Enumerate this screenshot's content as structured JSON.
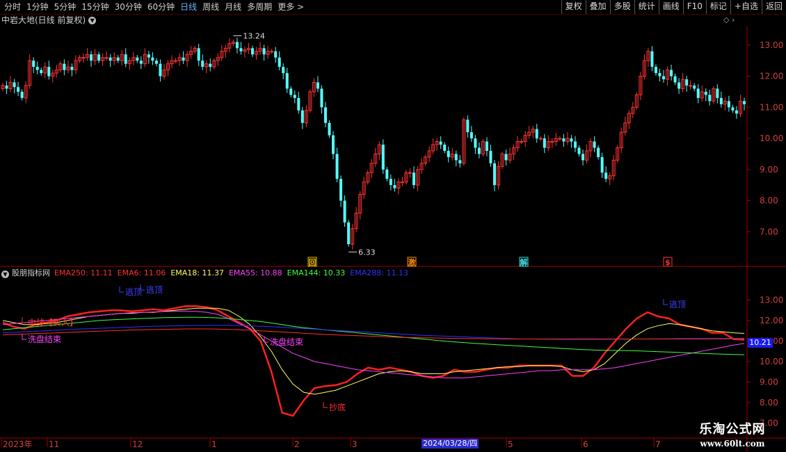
{
  "periods": [
    {
      "label": "分时",
      "active": false
    },
    {
      "label": "1分钟",
      "active": false
    },
    {
      "label": "5分钟",
      "active": false
    },
    {
      "label": "15分钟",
      "active": false
    },
    {
      "label": "30分钟",
      "active": false
    },
    {
      "label": "60分钟",
      "active": false
    },
    {
      "label": "日线",
      "active": true
    },
    {
      "label": "周线",
      "active": false
    },
    {
      "label": "月线",
      "active": false
    },
    {
      "label": "多周期",
      "active": false
    },
    {
      "label": "更多 >",
      "active": false
    }
  ],
  "tools": [
    "复权",
    "叠加",
    "多股",
    "统计",
    "画线",
    "F10",
    "标记",
    "+自选",
    "返回"
  ],
  "stock_title": "中岩大地(日线 前复权)",
  "price_axis": [
    "13.00",
    "12.00",
    "11.00",
    "10.00",
    "9.00",
    "8.00",
    "7.00"
  ],
  "high_label": "13.24",
  "low_label": "6.33",
  "markers": [
    {
      "text": "回",
      "color": "#f0c000"
    },
    {
      "text": "激",
      "color": "#ff8c00"
    },
    {
      "text": "解",
      "color": "#40e0e0"
    },
    {
      "text": "$",
      "color": "#ff3030"
    }
  ],
  "indicator": {
    "name": "股朋指标网",
    "emas": [
      {
        "label": "EMA250: 11.11",
        "color": "#ff3030"
      },
      {
        "label": "EMA6: 11.06",
        "color": "#ff3030"
      },
      {
        "label": "EMA18: 11.37",
        "color": "#ffff60"
      },
      {
        "label": "EMA55: 10.88",
        "color": "#ff40ff"
      },
      {
        "label": "EMA144: 10.33",
        "color": "#40ff40"
      },
      {
        "label": "EMA288: 11.13",
        "color": "#3030ff"
      }
    ],
    "axis": [
      "13.00",
      "12.00",
      "11.00",
      "10.00",
      "9.00",
      "8.00",
      "7.00"
    ],
    "last_value": "10.21",
    "annotations": [
      {
        "text": "中线【买入】",
        "color": "#ff3030"
      },
      {
        "text": "洗盘结束",
        "color": "#ff40ff"
      },
      {
        "text": "逃顶",
        "color": "#4040ff"
      },
      {
        "text": "逃顶",
        "color": "#4040ff"
      },
      {
        "text": "洗盘结束",
        "color": "#ff40ff"
      },
      {
        "text": "抄底",
        "color": "#ff3030"
      },
      {
        "text": "逃顶",
        "color": "#4040ff"
      }
    ]
  },
  "date_axis": [
    "2023年",
    "11",
    "12",
    "1",
    "2",
    "3",
    "5",
    "6",
    "7"
  ],
  "cursor_date": "2024/03/28/四",
  "watermark": {
    "line1": "乐淘公式网",
    "line2": "www.60lt.com"
  },
  "chart_data": [
    {
      "type": "candlestick",
      "title": "中岩大地(日线 前复权)",
      "y_range": [
        6.0,
        13.6
      ],
      "note": "close prices per day (approx.)",
      "close": [
        11.7,
        11.6,
        11.8,
        11.65,
        11.5,
        11.3,
        11.7,
        12.5,
        12.3,
        12.2,
        12.1,
        12.3,
        12.0,
        12.1,
        12.2,
        12.4,
        12.2,
        12.3,
        12.2,
        12.5,
        12.6,
        12.6,
        12.7,
        12.5,
        12.7,
        12.5,
        12.6,
        12.6,
        12.5,
        12.6,
        12.5,
        12.7,
        12.4,
        12.5,
        12.6,
        12.5,
        12.4,
        12.7,
        12.6,
        12.5,
        12.4,
        12.0,
        12.2,
        12.4,
        12.5,
        12.5,
        12.6,
        12.5,
        12.7,
        12.8,
        12.9,
        12.5,
        12.3,
        12.4,
        12.3,
        12.5,
        12.6,
        12.8,
        12.9,
        13.05,
        13.1,
        12.9,
        12.8,
        12.85,
        12.9,
        12.7,
        12.8,
        12.9,
        12.7,
        12.8,
        12.8,
        12.6,
        12.3,
        12.1,
        11.6,
        11.4,
        11.3,
        10.9,
        10.5,
        10.9,
        11.5,
        11.8,
        11.6,
        11.0,
        10.5,
        10.1,
        9.5,
        8.7,
        8.0,
        7.3,
        6.6,
        7.1,
        7.6,
        8.2,
        8.6,
        8.9,
        9.2,
        9.5,
        9.8,
        9.0,
        8.7,
        8.5,
        8.4,
        8.6,
        8.6,
        8.9,
        8.9,
        8.5,
        9.0,
        9.2,
        9.4,
        9.6,
        9.8,
        9.9,
        9.8,
        9.6,
        9.4,
        9.5,
        9.3,
        9.2,
        10.6,
        10.2,
        10.0,
        9.7,
        9.5,
        9.9,
        9.6,
        9.2,
        8.5,
        9.1,
        9.5,
        9.3,
        9.5,
        9.7,
        9.9,
        9.9,
        10.1,
        10.2,
        10.3,
        10.0,
        10.0,
        9.7,
        9.9,
        9.9,
        10.0,
        10.0,
        9.9,
        10.0,
        9.9,
        9.7,
        9.5,
        9.3,
        9.6,
        9.9,
        9.7,
        9.4,
        8.9,
        8.7,
        8.8,
        9.3,
        9.7,
        10.2,
        10.5,
        10.8,
        11.0,
        11.4,
        12.0,
        12.5,
        12.8,
        12.3,
        12.1,
        12.0,
        11.9,
        12.2,
        12.0,
        11.8,
        11.6,
        11.9,
        11.7,
        11.7,
        11.6,
        11.3,
        11.5,
        11.4,
        11.2,
        11.6,
        11.3,
        11.1,
        11.2,
        11.0,
        10.9,
        10.8,
        11.2,
        11.1
      ]
    },
    {
      "type": "line",
      "title": "股朋指标网",
      "y_range": [
        6.5,
        14.0
      ],
      "series": [
        {
          "name": "EMA6",
          "color": "#ff2020",
          "values": [
            11.9,
            11.7,
            11.6,
            11.8,
            11.9,
            12.0,
            12.2,
            12.3,
            12.4,
            12.45,
            12.5,
            12.5,
            12.45,
            12.5,
            12.55,
            12.5,
            12.6,
            12.7,
            12.7,
            12.65,
            12.5,
            12.2,
            11.9,
            11.6,
            11.0,
            9.5,
            7.5,
            7.35,
            8.1,
            8.7,
            8.8,
            8.85,
            9.0,
            9.4,
            9.7,
            9.6,
            9.7,
            9.6,
            9.5,
            9.3,
            9.2,
            9.3,
            9.6,
            9.5,
            9.5,
            9.6,
            9.7,
            9.7,
            9.8,
            9.8,
            9.8,
            9.8,
            9.8,
            9.3,
            9.3,
            9.7,
            10.4,
            11.0,
            11.6,
            12.1,
            12.4,
            12.2,
            12.1,
            11.8,
            11.7,
            11.6,
            11.4,
            11.4,
            11.1,
            11.06
          ]
        },
        {
          "name": "EMA18",
          "color": "#ffff60",
          "values": [
            12.0,
            11.9,
            11.8,
            11.8,
            11.85,
            11.9,
            12.0,
            12.1,
            12.2,
            12.25,
            12.3,
            12.35,
            12.35,
            12.4,
            12.4,
            12.45,
            12.5,
            12.55,
            12.6,
            12.6,
            12.6,
            12.5,
            12.2,
            11.8,
            11.2,
            10.5,
            9.6,
            8.9,
            8.5,
            8.4,
            8.5,
            8.6,
            8.8,
            9.0,
            9.2,
            9.4,
            9.5,
            9.55,
            9.5,
            9.4,
            9.4,
            9.4,
            9.5,
            9.55,
            9.6,
            9.65,
            9.7,
            9.75,
            9.75,
            9.8,
            9.8,
            9.8,
            9.75,
            9.6,
            9.5,
            9.6,
            9.9,
            10.4,
            10.9,
            11.3,
            11.6,
            11.75,
            11.85,
            11.8,
            11.7,
            11.6,
            11.5,
            11.45,
            11.4,
            11.37
          ]
        },
        {
          "name": "EMA55",
          "color": "#ff40ff",
          "values": [
            11.8,
            11.85,
            11.9,
            11.95,
            12.0,
            12.05,
            12.1,
            12.15,
            12.2,
            12.25,
            12.3,
            12.35,
            12.38,
            12.4,
            12.42,
            12.44,
            12.45,
            12.46,
            12.45,
            12.4,
            12.3,
            12.1,
            11.85,
            11.6,
            11.3,
            11.0,
            10.7,
            10.4,
            10.2,
            10.0,
            9.9,
            9.8,
            9.7,
            9.6,
            9.55,
            9.5,
            9.45,
            9.4,
            9.35,
            9.3,
            9.25,
            9.2,
            9.2,
            9.2,
            9.25,
            9.3,
            9.35,
            9.4,
            9.45,
            9.5,
            9.55,
            9.55,
            9.6,
            9.6,
            9.6,
            9.6,
            9.65,
            9.7,
            9.8,
            9.9,
            10.0,
            10.1,
            10.2,
            10.3,
            10.4,
            10.5,
            10.6,
            10.7,
            10.8,
            10.88
          ]
        },
        {
          "name": "EMA144",
          "color": "#40ff40",
          "values": [
            11.55,
            11.6,
            11.65,
            11.7,
            11.75,
            11.8,
            11.85,
            11.9,
            11.95,
            12.0,
            12.03,
            12.06,
            12.08,
            12.1,
            12.12,
            12.14,
            12.15,
            12.16,
            12.16,
            12.15,
            12.13,
            12.1,
            12.05,
            12.0,
            11.95,
            11.88,
            11.8,
            11.72,
            11.65,
            11.6,
            11.55,
            11.5,
            11.45,
            11.4,
            11.35,
            11.3,
            11.25,
            11.2,
            11.15,
            11.1,
            11.05,
            11.0,
            10.96,
            10.92,
            10.88,
            10.85,
            10.82,
            10.79,
            10.76,
            10.73,
            10.7,
            10.67,
            10.64,
            10.61,
            10.58,
            10.56,
            10.55,
            10.54,
            10.53,
            10.52,
            10.5,
            10.48,
            10.46,
            10.44,
            10.42,
            10.4,
            10.38,
            10.36,
            10.34,
            10.33
          ]
        },
        {
          "name": "EMA288",
          "color": "#3030ff",
          "values": [
            11.4,
            11.42,
            11.45,
            11.48,
            11.5,
            11.53,
            11.56,
            11.58,
            11.6,
            11.62,
            11.64,
            11.66,
            11.68,
            11.7,
            11.72,
            11.73,
            11.74,
            11.75,
            11.76,
            11.77,
            11.77,
            11.77,
            11.76,
            11.74,
            11.72,
            11.7,
            11.67,
            11.64,
            11.61,
            11.58,
            11.55,
            11.52,
            11.49,
            11.46,
            11.43,
            11.4,
            11.37,
            11.34,
            11.31,
            11.28,
            11.26,
            11.24,
            11.22,
            11.2,
            11.18,
            11.16,
            11.14,
            11.12,
            11.1,
            11.1,
            11.09,
            11.09,
            11.08,
            11.08,
            11.08,
            11.08,
            11.08,
            11.09,
            11.09,
            11.1,
            11.1,
            11.11,
            11.11,
            11.12,
            11.12,
            11.12,
            11.13,
            11.13,
            11.13,
            11.13
          ]
        },
        {
          "name": "EMA250",
          "color": "#ff3030",
          "values": [
            11.3,
            11.32,
            11.34,
            11.36,
            11.38,
            11.4,
            11.42,
            11.44,
            11.46,
            11.48,
            11.5,
            11.52,
            11.54,
            11.55,
            11.56,
            11.57,
            11.58,
            11.59,
            11.59,
            11.59,
            11.58,
            11.57,
            11.55,
            11.53,
            11.5,
            11.47,
            11.44,
            11.41,
            11.38,
            11.35,
            11.32,
            11.3,
            11.28,
            11.26,
            11.24,
            11.22,
            11.2,
            11.18,
            11.17,
            11.16,
            11.15,
            11.14,
            11.13,
            11.12,
            11.12,
            11.11,
            11.11,
            11.1,
            11.1,
            11.1,
            11.1,
            11.1,
            11.1,
            11.1,
            11.1,
            11.1,
            11.1,
            11.1,
            11.1,
            11.1,
            11.1,
            11.1,
            11.1,
            11.1,
            11.1,
            11.1,
            11.11,
            11.11,
            11.11,
            11.11
          ]
        }
      ]
    }
  ]
}
